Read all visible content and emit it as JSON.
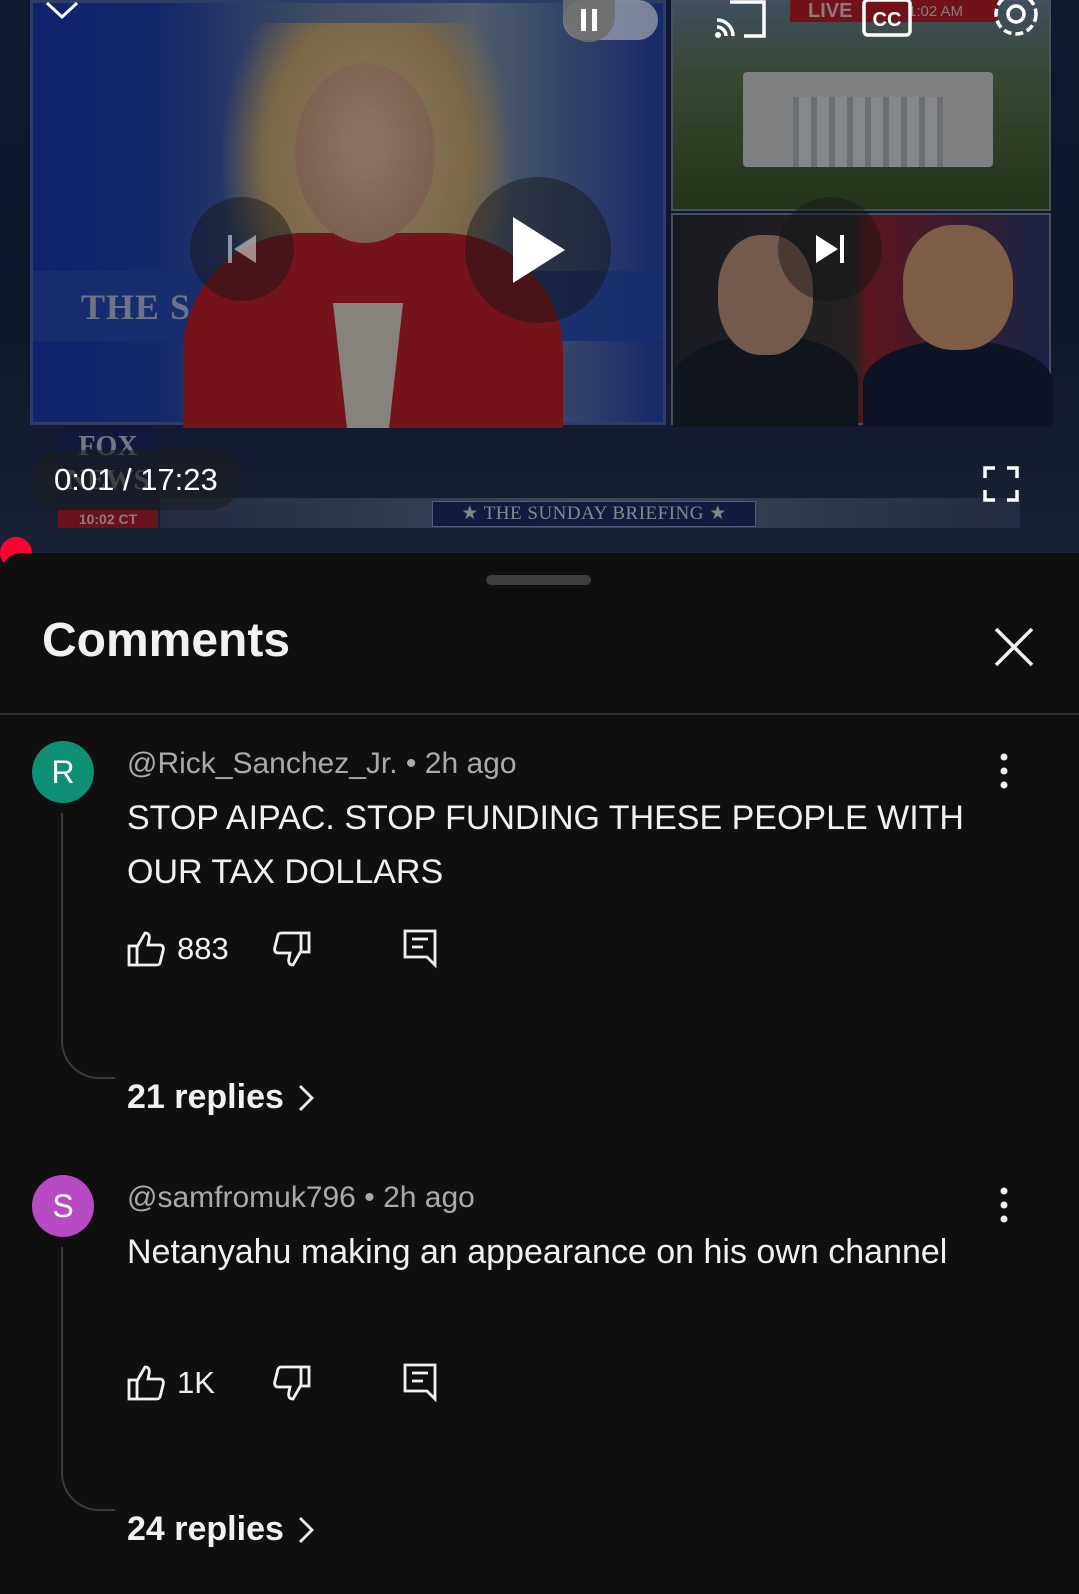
{
  "player": {
    "current_time": "0:01",
    "separator": " / ",
    "duration": "17:23",
    "live_label": "LIVE",
    "live_clock": "1:02 AM",
    "cc_label": "CC",
    "channel_logo": "FOX NEWS",
    "channel_clock": "10:02 CT",
    "ticker_text": "★ THE SUNDAY BRIEFING ★",
    "background_banner": "THE S",
    "progress_fraction": 0.0,
    "icons": [
      "chevron-down-icon",
      "pause-icon",
      "cast-icon",
      "cc-icon",
      "settings-icon",
      "previous-icon",
      "play-icon",
      "next-icon",
      "fullscreen-icon"
    ]
  },
  "comments_sheet": {
    "title": "Comments",
    "close_icon": "close-icon",
    "items": [
      {
        "avatar_letter": "R",
        "avatar_color": "#0f8f74",
        "author": "@Rick_Sanchez_Jr.",
        "time": "2h ago",
        "text": "STOP AIPAC. STOP FUNDING THESE PEOPLE WITH OUR TAX DOLLARS",
        "likes": "883",
        "replies_label": "21 replies"
      },
      {
        "avatar_letter": "S",
        "avatar_color": "#b64bc4",
        "author": "@samfromuk796",
        "time": "2h ago",
        "text": "Netanyahu making an appearance on his own channel",
        "likes": "1K",
        "replies_label": "24 replies"
      }
    ]
  },
  "colors": {
    "background": "#0f0f0f",
    "progress_red": "#ff0033",
    "secondary_text": "#aaaaaa"
  }
}
